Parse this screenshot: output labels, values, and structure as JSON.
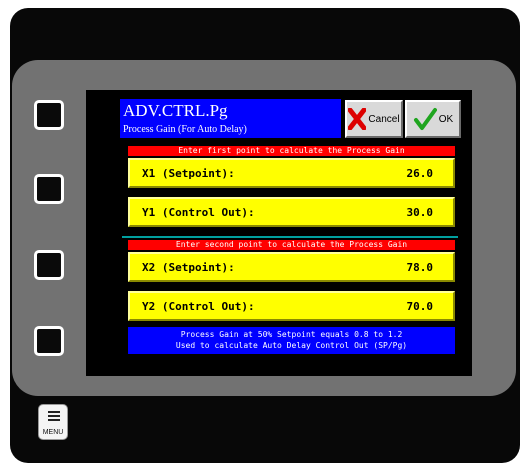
{
  "header": {
    "title": "ADV.CTRL.Pg",
    "subtitle": "Process Gain (For Auto Delay)"
  },
  "buttons": {
    "cancel_label": "Cancel",
    "ok_label": "OK",
    "menu_label": "MENU"
  },
  "first_point": {
    "banner": "Enter first point to calculate the Process Gain",
    "x1_label": "X1 (Setpoint):",
    "x1_value": "26.0",
    "y1_label": "Y1 (Control Out):",
    "y1_value": "30.0"
  },
  "second_point": {
    "banner": "Enter second point to calculate the Process Gain",
    "x2_label": "X2 (Setpoint):",
    "x2_value": "78.0",
    "y2_label": "Y2 (Control Out):",
    "y2_value": "70.0"
  },
  "note": {
    "line1": "Process Gain at 50% Setpoint equals 0.8 to 1.2",
    "line2": "Used to calculate Auto Delay Control Out (SP/Pg)"
  },
  "icons": {
    "cancel": "red-x-icon",
    "ok": "green-check-icon",
    "menu": "menu-icon"
  },
  "colors": {
    "title_bg": "#0000ff",
    "banner_bg": "#ff0000",
    "field_bg": "#ffff00",
    "note_bg": "#0000ff",
    "screen_bg": "#000000"
  }
}
